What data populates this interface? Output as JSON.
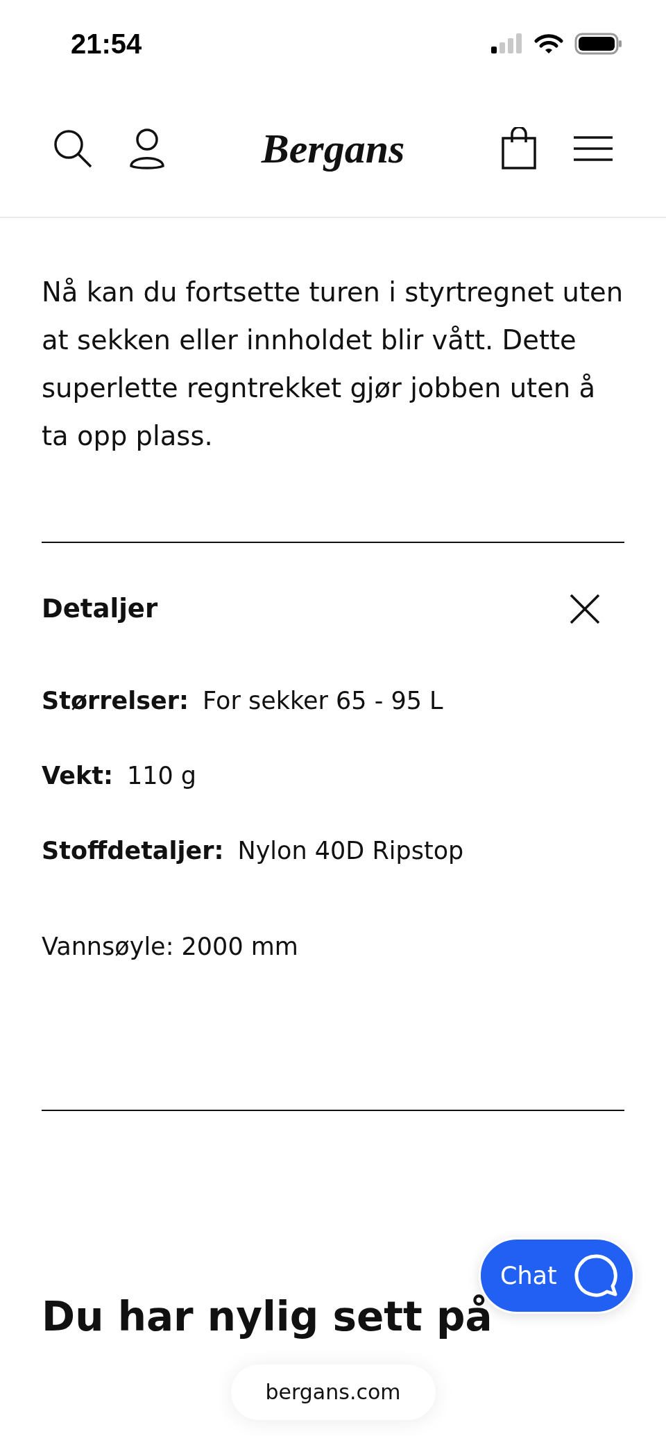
{
  "status_bar": {
    "time": "21:54"
  },
  "header": {
    "logo": "Bergans"
  },
  "description": "Nå kan du fortsette turen i styrtregnet uten at sekken eller innholdet blir vått. Dette superlette regntrekket gjør jobben uten å ta opp plass.",
  "details": {
    "title": "Detaljer",
    "expanded": true,
    "specs": [
      {
        "label": "Størrelser:",
        "value": "For sekker 65 - 95 L"
      },
      {
        "label": "Vekt:",
        "value": "110 g"
      },
      {
        "label": "Stoffdetaljer:",
        "value": "Nylon 40D Ripstop"
      }
    ],
    "notes": [
      "Vannsøyle: 2000 mm"
    ]
  },
  "section_heading": "Du har nylig sett på",
  "chat_button": {
    "label": "Chat"
  },
  "browser": {
    "url": "bergans.com"
  }
}
